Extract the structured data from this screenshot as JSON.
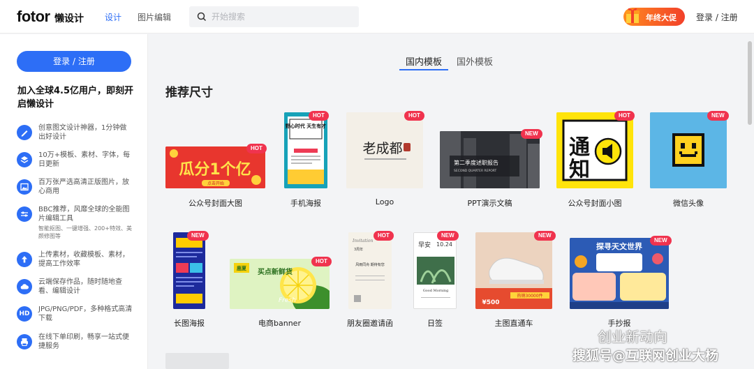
{
  "header": {
    "logo_text": "fotor",
    "logo_sub": "懒设计",
    "nav": [
      "设计",
      "图片编辑"
    ],
    "search_placeholder": "开始搜索",
    "promo_label": "年终大促",
    "auth_label": "登录 / 注册"
  },
  "sidebar": {
    "login_button": "登录 / 注册",
    "join_title": "加入全球4.5亿用户，即刻开启懒设计",
    "features": [
      {
        "icon": "pen-icon",
        "text": "创意图文设计神器，1分钟做出好设计"
      },
      {
        "icon": "layers-icon",
        "text": "10万+模板、素材、字体，每日更新"
      },
      {
        "icon": "image-icon",
        "text": "百万张严选高清正版图片，放心商用"
      },
      {
        "icon": "sliders-icon",
        "text": "BBC推荐，风靡全球的全能图片编辑工具",
        "sub": "智能抠图、一键增强、200+特效、美颜修图等"
      },
      {
        "icon": "upload-icon",
        "text": "上传素材，收藏模板、素材，提高工作效率"
      },
      {
        "icon": "cloud-icon",
        "text": "云端保存作品，随时随地查看、编辑设计"
      },
      {
        "icon": "hd-icon",
        "badge": "HD",
        "text": "JPG/PNG/PDF，多种格式高清下载"
      },
      {
        "icon": "print-icon",
        "text": "在线下单印刷，畅享一站式便捷服务"
      }
    ]
  },
  "main": {
    "tabs": [
      "国内模板",
      "国外模板"
    ],
    "section_title": "推荐尺寸",
    "row1": [
      {
        "label": "公众号封面大图",
        "badge": "HOT",
        "thumb_text": "瓜分1个亿",
        "thumb_sub": "点击开始"
      },
      {
        "label": "手机海报",
        "badge": "HOT",
        "thumb_text": "野心时代 天生有才"
      },
      {
        "label": "Logo",
        "badge": "HOT",
        "thumb_text": "老成都"
      },
      {
        "label": "PPT演示文稿",
        "badge": "NEW",
        "thumb_text": "第二季度述职报告",
        "thumb_sub": "SECOND QUARTER REPORT"
      },
      {
        "label": "公众号封面小图",
        "badge": "HOT",
        "thumb_text": "通知"
      },
      {
        "label": "微信头像",
        "badge": "NEW"
      }
    ],
    "row2": [
      {
        "label": "长图海报",
        "badge": "NEW"
      },
      {
        "label": "电商banner",
        "badge": "HOT",
        "thumb_text": "买点新鲜货",
        "thumb_sub": "Fresh"
      },
      {
        "label": "朋友圈邀请函",
        "badge": "HOT",
        "thumb_text": "风雨同舟 期待有您"
      },
      {
        "label": "日签",
        "badge": "NEW",
        "thumb_text": "10.24",
        "thumb_sub": "Good Morning"
      },
      {
        "label": "主图直通车",
        "badge": "NEW",
        "thumb_text": "¥500",
        "thumb_sub": "热销30000件"
      },
      {
        "label": "手抄报",
        "badge": "NEW",
        "thumb_text": "探寻天文世界"
      }
    ]
  },
  "watermark": {
    "line1": "创业新动向",
    "line2": "搜狐号@互联网创业大杨"
  },
  "colors": {
    "accent": "#2d6ef6",
    "badge": "#f0334e",
    "promo": "#f2402a"
  }
}
